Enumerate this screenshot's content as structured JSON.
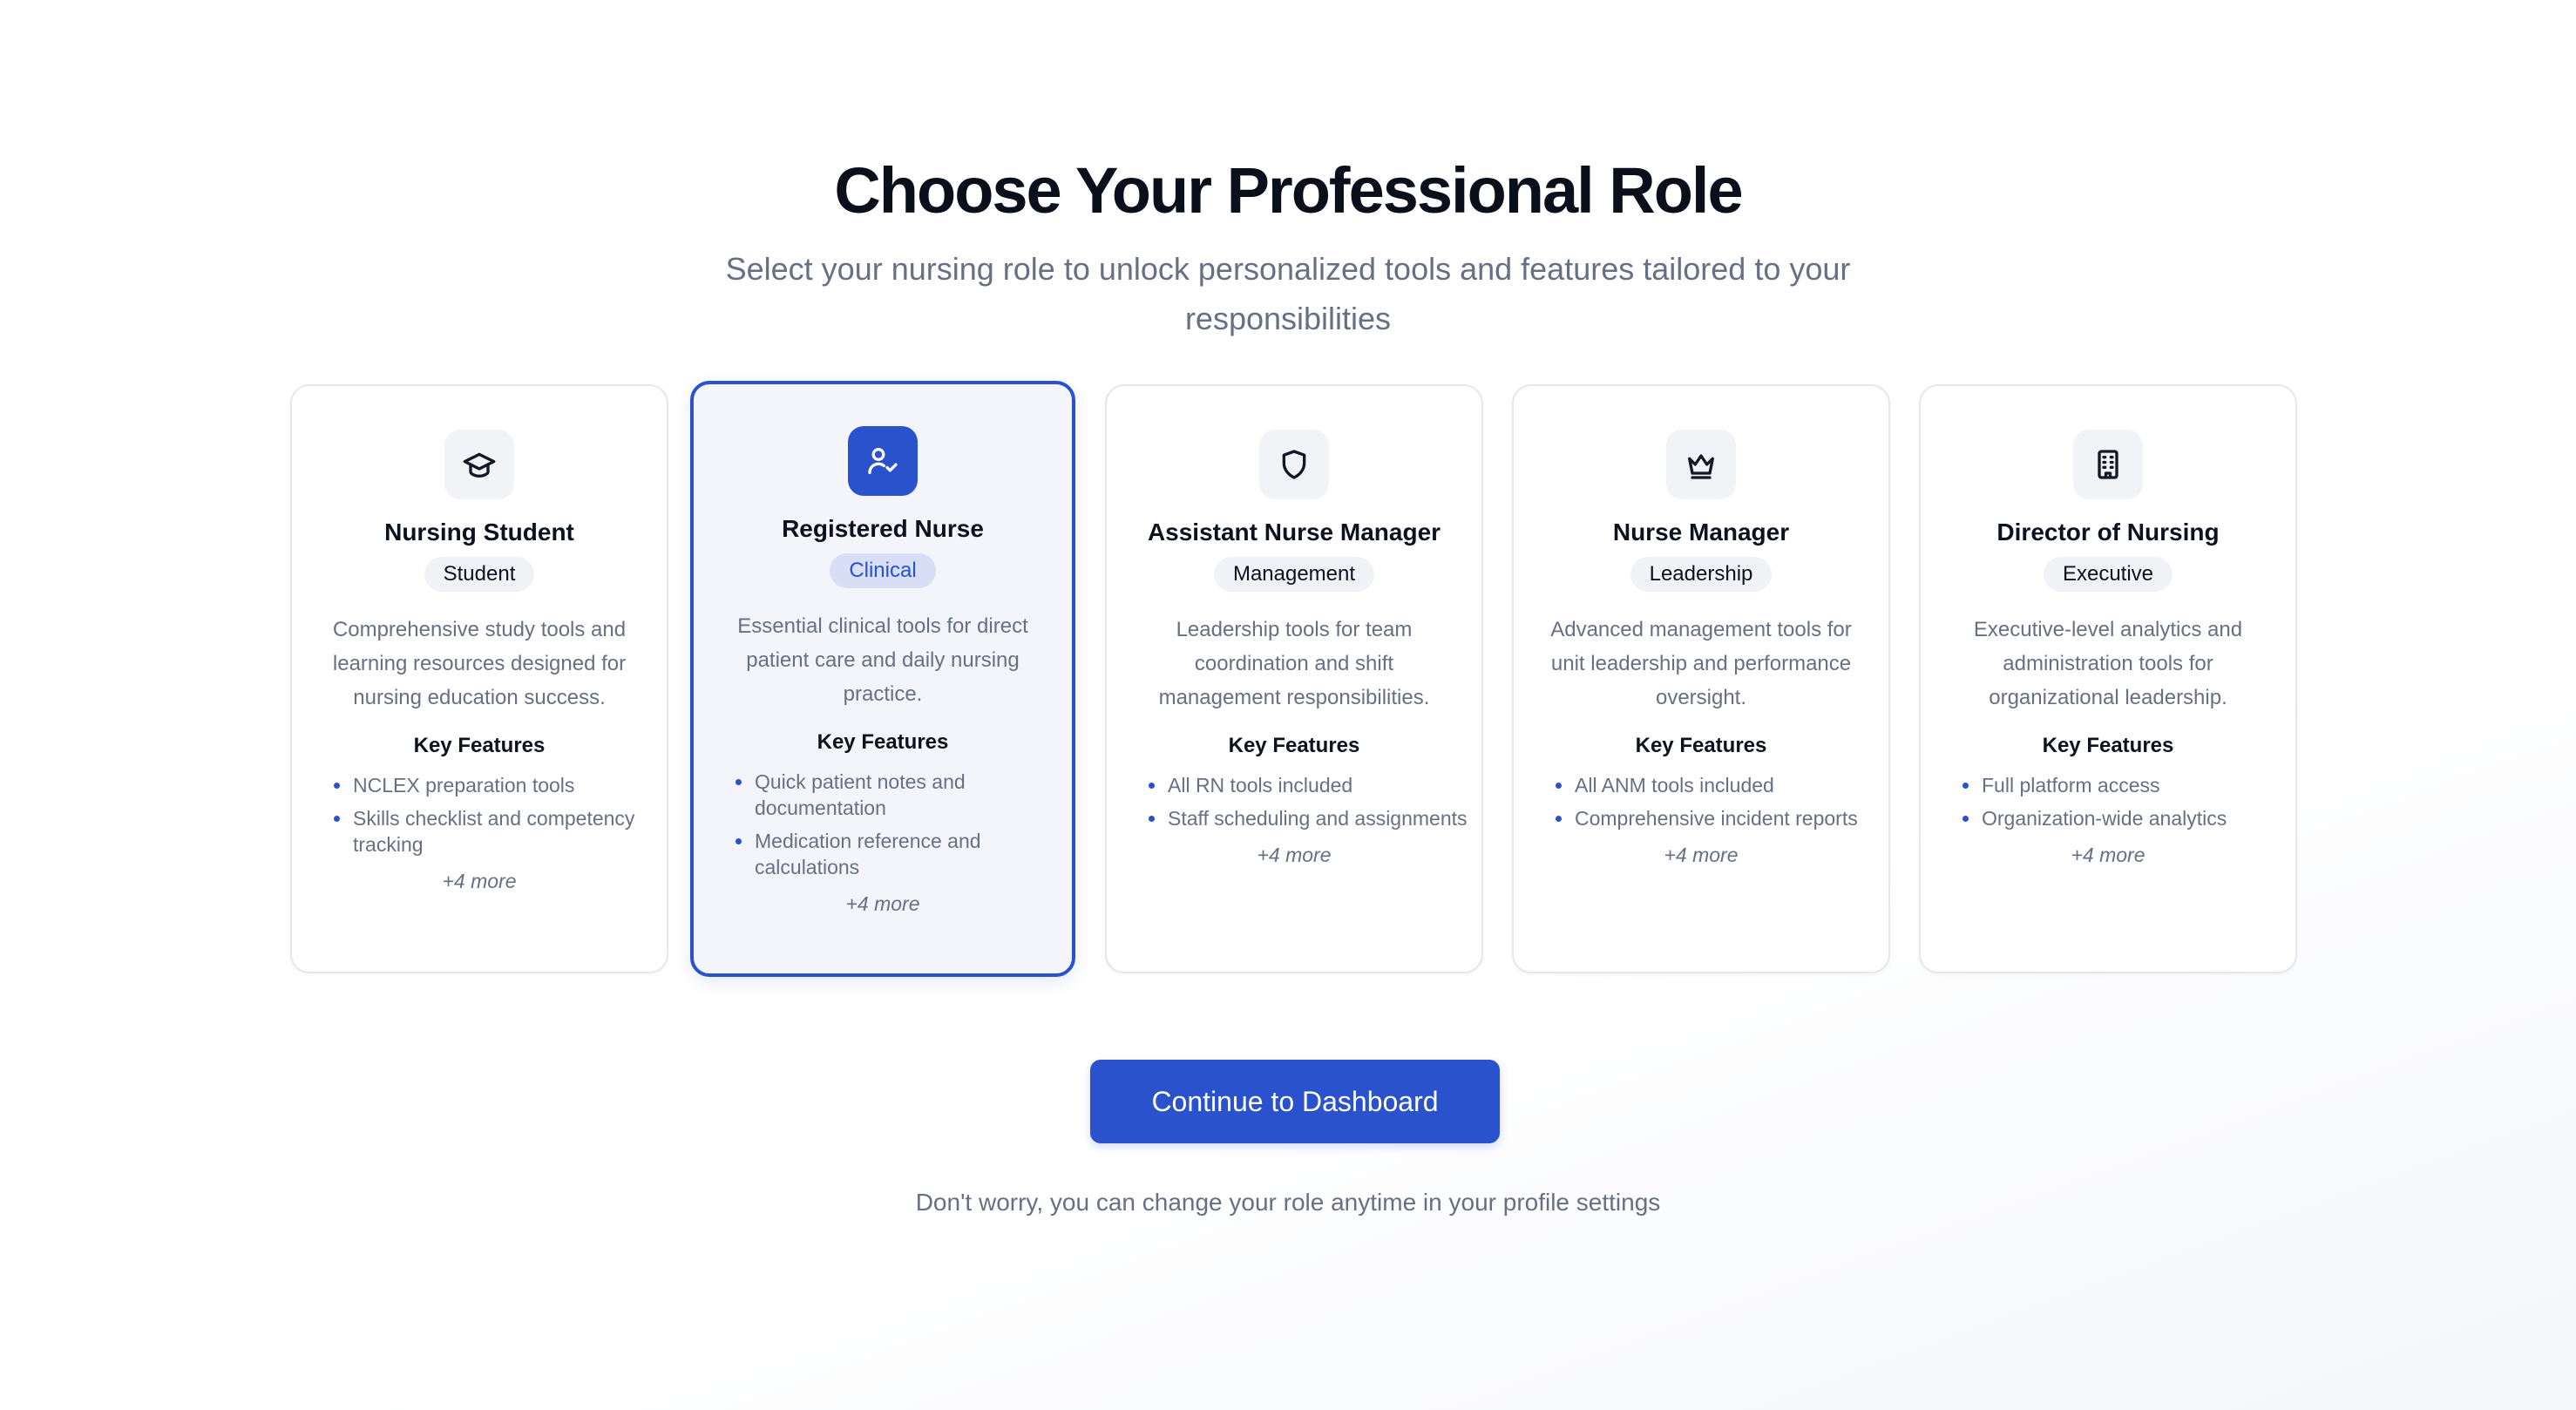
{
  "header": {
    "title": "Choose Your Professional Role",
    "subtitle": "Select your nursing role to unlock personalized tools and features tailored to your responsibilities"
  },
  "selected_role": "Registered Nurse",
  "roles": [
    {
      "title": "Nursing Student",
      "icon": "graduation-cap-icon",
      "badge": "Student",
      "description": "Comprehensive study tools and learning resources designed for nursing education success.",
      "key_features_label": "Key Features",
      "features": [
        "NCLEX preparation tools",
        "Skills checklist and competency tracking"
      ],
      "more": "+4 more"
    },
    {
      "title": "Registered Nurse",
      "icon": "user-check-icon",
      "badge": "Clinical",
      "description": "Essential clinical tools for direct patient care and daily nursing practice.",
      "key_features_label": "Key Features",
      "features": [
        "Quick patient notes and documentation",
        "Medication reference and calculations"
      ],
      "more": "+4 more"
    },
    {
      "title": "Assistant Nurse Manager",
      "icon": "shield-icon",
      "badge": "Management",
      "description": "Leadership tools for team coordination and shift management responsibilities.",
      "key_features_label": "Key Features",
      "features": [
        "All RN tools included",
        "Staff scheduling and assignments"
      ],
      "more": "+4 more"
    },
    {
      "title": "Nurse Manager",
      "icon": "crown-icon",
      "badge": "Leadership",
      "description": "Advanced management tools for unit leadership and performance oversight.",
      "key_features_label": "Key Features",
      "features": [
        "All ANM tools included",
        "Comprehensive incident reports"
      ],
      "more": "+4 more"
    },
    {
      "title": "Director of Nursing",
      "icon": "building-icon",
      "badge": "Executive",
      "description": "Executive-level analytics and administration tools for organizational leadership.",
      "key_features_label": "Key Features",
      "features": [
        "Full platform access",
        "Organization-wide analytics"
      ],
      "more": "+4 more"
    }
  ],
  "cta": {
    "label": "Continue to Dashboard"
  },
  "footnote": "Don't worry, you can change your role anytime in your profile settings",
  "colors": {
    "accent": "#2952cc",
    "muted_text": "#667085",
    "heading": "#0a0f1c",
    "selected_card_bg": "#f3f5fa",
    "badge_bg": "#f0f2f5",
    "selected_badge_bg": "#d7def5"
  }
}
